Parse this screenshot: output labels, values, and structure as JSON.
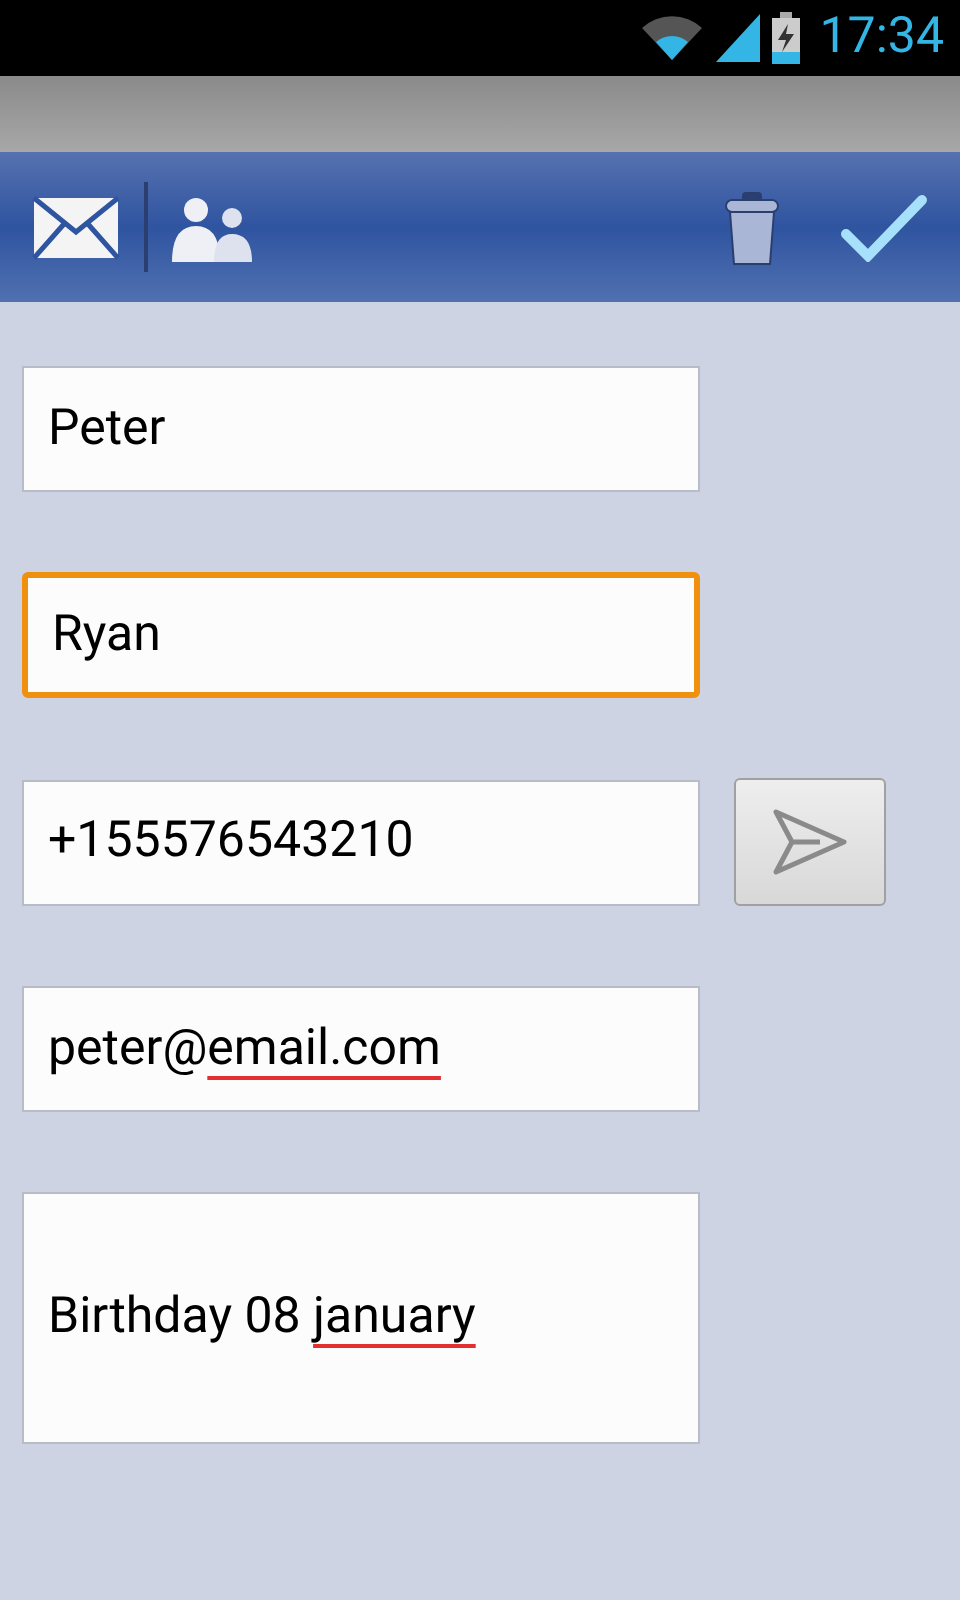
{
  "status_bar": {
    "time": "17:34"
  },
  "fields": [
    {
      "kind": "single",
      "focused": false,
      "parts": [
        {
          "text": "Peter",
          "misspelled": false
        }
      ]
    },
    {
      "kind": "single",
      "focused": true,
      "parts": [
        {
          "text": "Ryan",
          "misspelled": false
        }
      ]
    },
    {
      "kind": "phone",
      "focused": false,
      "parts": [
        {
          "text": "+155576543210",
          "misspelled": false
        }
      ]
    },
    {
      "kind": "single",
      "focused": false,
      "parts": [
        {
          "text": "peter@",
          "misspelled": false
        },
        {
          "text": "email.com",
          "misspelled": true
        }
      ]
    },
    {
      "kind": "multiline",
      "focused": false,
      "parts": [
        {
          "text": "Birthday 08 ",
          "misspelled": false
        },
        {
          "text": "january",
          "misspelled": true
        }
      ]
    }
  ]
}
